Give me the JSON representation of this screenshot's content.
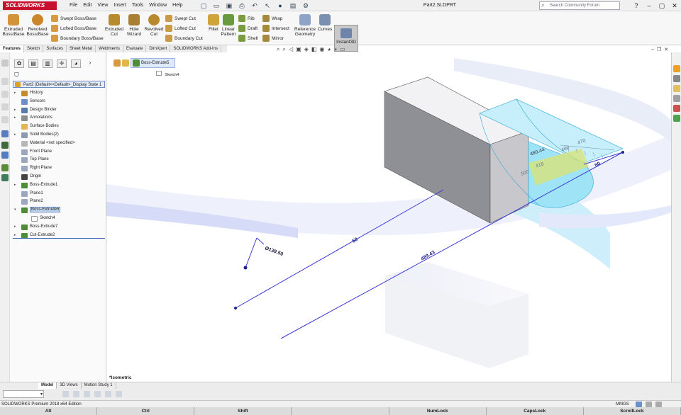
{
  "app": {
    "name": "SOLIDWORKS",
    "document_title": "Part2.SLDPRT"
  },
  "menu": [
    "File",
    "Edit",
    "View",
    "Insert",
    "Tools",
    "Window",
    "Help"
  ],
  "search": {
    "placeholder": "Search Community Forum"
  },
  "ribbon": {
    "extruded_boss": "Extruded Boss/Base",
    "revolved_boss": "Revolved Boss/Base",
    "swept_boss": "Swept Boss/Base",
    "lofted_boss": "Lofted Boss/Base",
    "boundary_boss": "Boundary Boss/Base",
    "extruded_cut": "Extruded Cut",
    "hole_wizard": "Hole Wizard",
    "revolved_cut": "Revolved Cut",
    "swept_cut": "Swept Cut",
    "lofted_cut": "Lofted Cut",
    "boundary_cut": "Boundary Cut",
    "fillet": "Fillet",
    "linear_pattern": "Linear Pattern",
    "rib": "Rib",
    "draft": "Draft",
    "shell": "Shell",
    "wrap": "Wrap",
    "intersect": "Intersect",
    "mirror": "Mirror",
    "reference_geometry": "Reference Geometry",
    "curves": "Curves",
    "instant3d": "Instant3D"
  },
  "tabs": [
    "Features",
    "Sketch",
    "Surfaces",
    "Sheet Metal",
    "Weldments",
    "Evaluate",
    "DimXpert",
    "SOLIDWORKS Add-Ins"
  ],
  "tree": {
    "root": "Part2 (Default<<Default>_Display State 1",
    "items": [
      {
        "label": "History",
        "color": "#c98b2a"
      },
      {
        "label": "Sensors",
        "color": "#6a8fc9"
      },
      {
        "label": "Design Binder",
        "color": "#5a7aa8"
      },
      {
        "label": "Annotations",
        "color": "#8d8d8d"
      },
      {
        "label": "Surface Bodies",
        "color": "#e0b84a"
      },
      {
        "label": "Solid Bodies(2)",
        "color": "#8c9bb0"
      },
      {
        "label": "Material <not specified>",
        "color": "#b7b7b7"
      },
      {
        "label": "Front Plane",
        "color": "#9aa7bd"
      },
      {
        "label": "Top Plane",
        "color": "#9aa7bd"
      },
      {
        "label": "Right Plane",
        "color": "#9aa7bd"
      },
      {
        "label": "Origin",
        "color": "#444444"
      },
      {
        "label": "Boss-Extrude1",
        "color": "#4f8c3a"
      },
      {
        "label": "Plane1",
        "color": "#9aa7bd"
      },
      {
        "label": "Plane2",
        "color": "#9aa7bd"
      },
      {
        "label": "Boss-Extrude5",
        "color": "#4f8c3a"
      },
      {
        "label": "Sketch4",
        "color": "#ffffff"
      },
      {
        "label": "Boss-Extrude7",
        "color": "#4f8c3a"
      },
      {
        "label": "Cut-Extrude2",
        "color": "#4f8c3a"
      }
    ]
  },
  "flyout": {
    "feature": "Boss-Extrude5",
    "sketch": "Sketch4"
  },
  "dimensions": {
    "d1": "50",
    "d2": "489.43",
    "d3": "Ø139.50",
    "d4": "50",
    "r1": "470",
    "r2": "480",
    "r3": "418",
    "r4": "500",
    "r5": "480.44"
  },
  "view_name": "*Isometric",
  "bottom_tabs": [
    "Model",
    "3D Views",
    "Motion Study 1"
  ],
  "status": {
    "edition": "SOLIDWORKS Premium 2018 x64 Edition",
    "units": "MMGS"
  },
  "keys": [
    "Alt",
    "Ctrl",
    "Shift",
    "",
    "NumLock",
    "CapsLock",
    "ScrollLock"
  ],
  "colors": {
    "brand_red": "#c8102e",
    "selection_blue": "#3b3bd6",
    "preview_cyan": "#9fe3f7",
    "gray_body": "#8f8f96"
  }
}
